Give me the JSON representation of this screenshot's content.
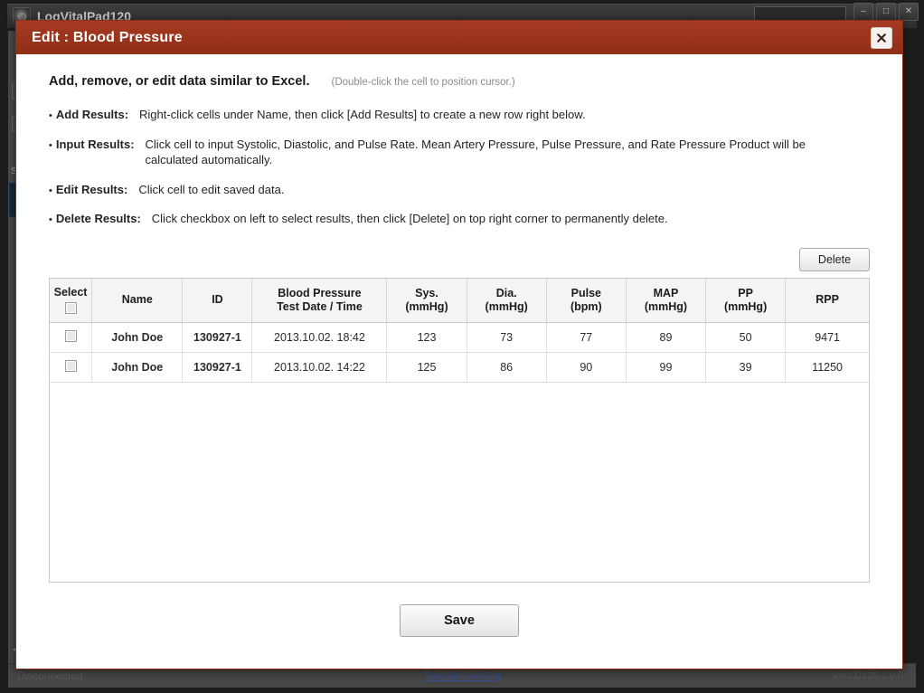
{
  "background_app": {
    "title": "LogVitalPad120",
    "window_controls": [
      {
        "name": "minimize",
        "glyph": "–"
      },
      {
        "name": "maximize",
        "glyph": "□"
      },
      {
        "name": "close",
        "glyph": "✕"
      }
    ],
    "sidebar_label": "Se",
    "statusbar": {
      "connection": "Disconnected",
      "link": "Troubleshooting",
      "version": "Ver.LD120.1.0.0"
    }
  },
  "dialog": {
    "title": "Edit : Blood Pressure",
    "close_label": "✕",
    "instructions": {
      "headline": "Add, remove, or edit data similar to Excel.",
      "hint": "(Double-click the cell to position cursor.)",
      "items": [
        {
          "bullet": "•",
          "label": "Add Results:",
          "text": "Right-click cells under Name, then click [Add Results] to create a new row right below."
        },
        {
          "bullet": "•",
          "label": "Input Results:",
          "text": "Click cell to input Systolic, Diastolic, and Pulse Rate. Mean Artery Pressure, Pulse Pressure, and Rate Pressure Product will be calculated automatically."
        },
        {
          "bullet": "•",
          "label": "Edit Results:",
          "text": "Click cell to edit saved data."
        },
        {
          "bullet": "•",
          "label": "Delete Results:",
          "text": "Click checkbox on left to select results, then click [Delete] on top right corner to permanently delete."
        }
      ]
    },
    "toolbar": {
      "delete_label": "Delete"
    },
    "table": {
      "columns": [
        {
          "line1": "Select",
          "line2": ""
        },
        {
          "line1": "Name",
          "line2": ""
        },
        {
          "line1": "ID",
          "line2": ""
        },
        {
          "line1": "Blood Pressure",
          "line2": "Test Date / Time"
        },
        {
          "line1": "Sys.",
          "line2": "(mmHg)"
        },
        {
          "line1": "Dia.",
          "line2": "(mmHg)"
        },
        {
          "line1": "Pulse",
          "line2": "(bpm)"
        },
        {
          "line1": "MAP",
          "line2": "(mmHg)"
        },
        {
          "line1": "PP",
          "line2": "(mmHg)"
        },
        {
          "line1": "RPP",
          "line2": ""
        }
      ],
      "rows": [
        {
          "selected": false,
          "name": "John Doe",
          "id": "130927-1",
          "datetime": "2013.10.02. 18:42",
          "datetime_highlighted": true,
          "sys": "123",
          "dia": "73",
          "pulse": "77",
          "map": "89",
          "pp": "50",
          "rpp": "9471"
        },
        {
          "selected": false,
          "name": "John Doe",
          "id": "130927-1",
          "datetime": "2013.10.02. 14:22",
          "datetime_highlighted": false,
          "sys": "125",
          "dia": "86",
          "pulse": "90",
          "map": "99",
          "pp": "39",
          "rpp": "11250"
        }
      ]
    },
    "save_label": "Save"
  },
  "colors": {
    "title_bar": "#a63a22",
    "selected_cell": "#c8c8c8",
    "header_bg": "#f4f4f4"
  }
}
